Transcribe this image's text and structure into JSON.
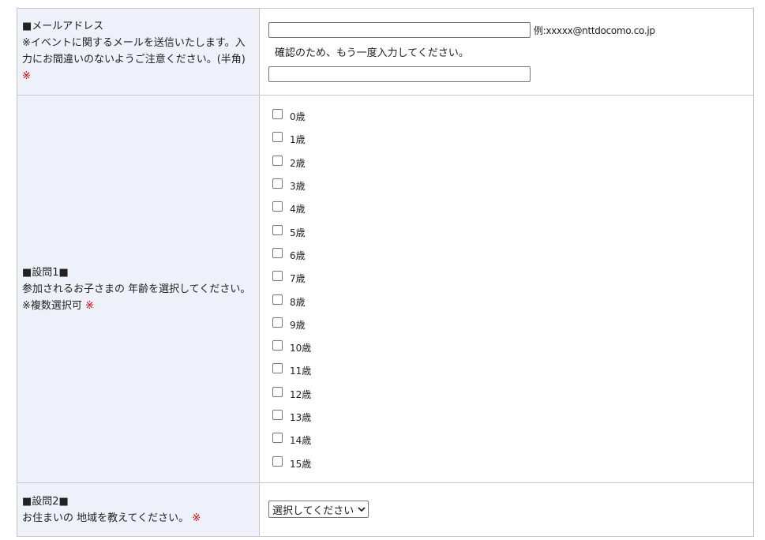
{
  "email_section": {
    "label_title": "■メールアドレス",
    "label_desc": "※イベントに関するメールを送信いたします。入力にお間違いのないようご注意ください。(半角)",
    "required_mark": "※",
    "input_value": "",
    "example_text": "例:xxxxx@nttdocomo.co.jp",
    "confirm_text": "確認のため、もう一度入力してください。",
    "confirm_input_value": ""
  },
  "question1": {
    "title": "■設問1■",
    "desc": "参加されるお子さまの 年齢を選択してください。",
    "note": "※複数選択可",
    "required_mark": "※",
    "options": [
      "0歳",
      "1歳",
      "2歳",
      "3歳",
      "4歳",
      "5歳",
      "6歳",
      "7歳",
      "8歳",
      "9歳",
      "10歳",
      "11歳",
      "12歳",
      "13歳",
      "14歳",
      "15歳"
    ]
  },
  "question2": {
    "title": "■設問2■",
    "desc": "お住まいの 地域を教えてください。",
    "required_mark": "※",
    "select_value": "選択してください"
  },
  "icons": {
    "dropdown": "chevron-down-icon"
  }
}
